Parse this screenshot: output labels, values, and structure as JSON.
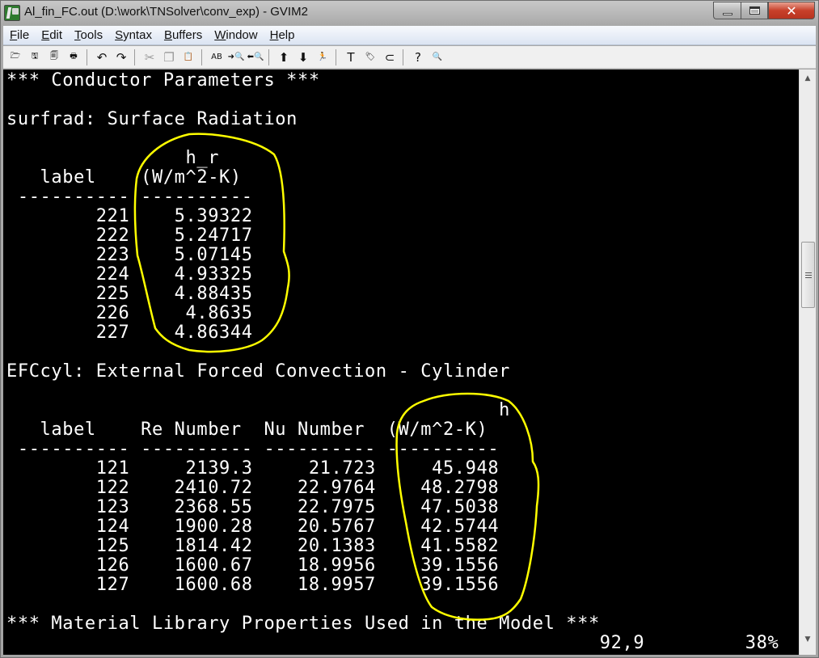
{
  "window": {
    "title": "Al_fin_FC.out (D:\\work\\TNSolver\\conv_exp) - GVIM2",
    "controls": {
      "minimize": "minimize",
      "maximize": "maximize",
      "close": "✕"
    }
  },
  "menubar": {
    "items": [
      {
        "label": "File",
        "mnemonic": "F",
        "rest": "ile"
      },
      {
        "label": "Edit",
        "mnemonic": "E",
        "rest": "dit"
      },
      {
        "label": "Tools",
        "mnemonic": "T",
        "rest": "ools"
      },
      {
        "label": "Syntax",
        "mnemonic": "S",
        "rest": "yntax"
      },
      {
        "label": "Buffers",
        "mnemonic": "B",
        "rest": "uffers"
      },
      {
        "label": "Window",
        "mnemonic": "W",
        "rest": "indow"
      },
      {
        "label": "Help",
        "mnemonic": "H",
        "rest": "elp"
      }
    ]
  },
  "toolbar": {
    "groups": [
      [
        {
          "name": "open-icon",
          "glyph": "🗁",
          "enabled": true
        },
        {
          "name": "save-icon",
          "glyph": "🖫",
          "enabled": true
        },
        {
          "name": "save-all-icon",
          "glyph": "🗐",
          "enabled": true
        },
        {
          "name": "print-icon",
          "glyph": "🖶",
          "enabled": true
        }
      ],
      [
        {
          "name": "undo-icon",
          "glyph": "↶",
          "enabled": true
        },
        {
          "name": "redo-icon",
          "glyph": "↷",
          "enabled": true
        }
      ],
      [
        {
          "name": "cut-icon",
          "glyph": "✂",
          "enabled": false
        },
        {
          "name": "copy-icon",
          "glyph": "❐",
          "enabled": false
        },
        {
          "name": "paste-icon",
          "glyph": "📋",
          "enabled": true
        }
      ],
      [
        {
          "name": "find-replace-icon",
          "glyph": "AB",
          "enabled": true
        },
        {
          "name": "find-next-icon",
          "glyph": "➜🔍",
          "enabled": true
        },
        {
          "name": "find-prev-icon",
          "glyph": "⬅🔍",
          "enabled": true
        }
      ],
      [
        {
          "name": "load-session-icon",
          "glyph": "⬆",
          "enabled": true
        },
        {
          "name": "save-session-icon",
          "glyph": "⬇",
          "enabled": true
        },
        {
          "name": "run-script-icon",
          "glyph": "🏃",
          "enabled": true
        }
      ],
      [
        {
          "name": "make-icon",
          "glyph": "T",
          "enabled": true
        },
        {
          "name": "build-tags-icon",
          "glyph": "🏷",
          "enabled": true
        },
        {
          "name": "jump-tag-icon",
          "glyph": "⊂",
          "enabled": true
        }
      ],
      [
        {
          "name": "help-icon",
          "glyph": "?",
          "enabled": true
        },
        {
          "name": "find-help-icon",
          "glyph": "🔍",
          "enabled": true
        }
      ]
    ]
  },
  "buffer": {
    "lines": [
      "*** Conductor Parameters ***",
      "",
      "surfrad: Surface Radiation",
      "",
      "                h_r",
      "   label    (W/m^2-K)",
      " ---------- ----------",
      "        221    5.39322",
      "        222    5.24717",
      "        223    5.07145",
      "        224    4.93325",
      "        225    4.88435",
      "        226     4.8635",
      "        227    4.86344",
      "",
      "EFCcyl: External Forced Convection - Cylinder",
      "",
      "                                            h",
      "   label    Re Number  Nu Number  (W/m^2-K)",
      " ---------- ---------- ---------- ----------",
      "        121     2139.3     21.723     45.948",
      "        122    2410.72    22.9764    48.2798",
      "        123    2368.55    22.7975    47.5038",
      "        124    1900.28    20.5767    42.5744",
      "        125    1814.42    20.1383    41.5582",
      "        126    1600.67    18.9956    39.1556",
      "        127    1600.68    18.9957    39.1556",
      "",
      "*** Material Library Properties Used in the Model ***"
    ],
    "surfrad_table": {
      "title": "surfrad: Surface Radiation",
      "columns": [
        "label",
        "h_r (W/m^2-K)"
      ],
      "rows": [
        [
          "221",
          "5.39322"
        ],
        [
          "222",
          "5.24717"
        ],
        [
          "223",
          "5.07145"
        ],
        [
          "224",
          "4.93325"
        ],
        [
          "225",
          "4.88435"
        ],
        [
          "226",
          "4.8635"
        ],
        [
          "227",
          "4.86344"
        ]
      ]
    },
    "efccyl_table": {
      "title": "EFCcyl: External Forced Convection - Cylinder",
      "columns": [
        "label",
        "Re Number",
        "Nu Number",
        "h (W/m^2-K)"
      ],
      "rows": [
        [
          "121",
          "2139.3",
          "21.723",
          "45.948"
        ],
        [
          "122",
          "2410.72",
          "22.9764",
          "48.2798"
        ],
        [
          "123",
          "2368.55",
          "22.7975",
          "47.5038"
        ],
        [
          "124",
          "1900.28",
          "20.5767",
          "42.5744"
        ],
        [
          "125",
          "1814.42",
          "20.1383",
          "41.5582"
        ],
        [
          "126",
          "1600.67",
          "18.9956",
          "39.1556"
        ],
        [
          "127",
          "1600.68",
          "18.9957",
          "39.1556"
        ]
      ]
    },
    "annotations": {
      "color": "#ffff00",
      "circled_columns": [
        "h_r (W/m^2-K)",
        "h (W/m^2-K)"
      ]
    }
  },
  "statusline": {
    "text": "                                                     92,9         38%",
    "cursor_position": "92,9",
    "scroll_percent": "38%"
  },
  "scrollbar": {
    "position_percent": 38
  }
}
